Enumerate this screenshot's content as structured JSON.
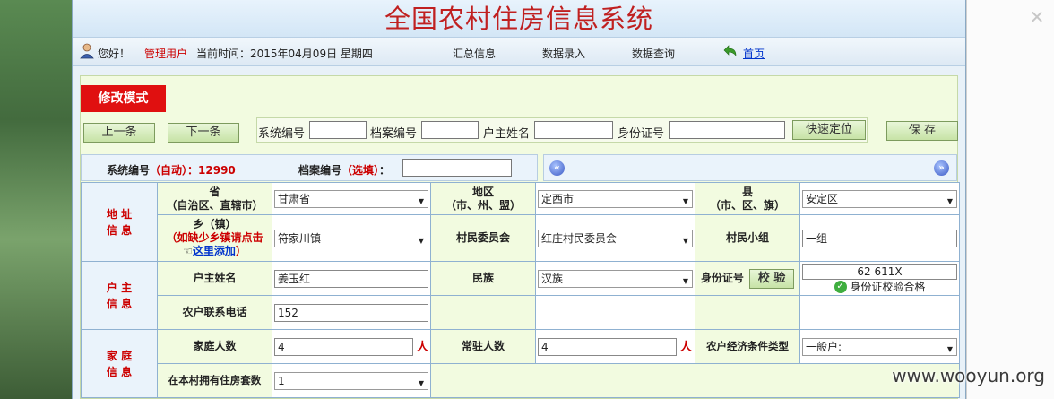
{
  "title": "全国农村住房信息系统",
  "menu": {
    "greeting": "您好！",
    "user": "管理用户",
    "time_label": "当前时间：2015年04月09日 星期四",
    "nav": [
      "汇总信息",
      "数据录入",
      "数据查询"
    ],
    "home": "首页"
  },
  "mode": "修改模式",
  "toolbar": {
    "prev": "上一条",
    "next": "下一条",
    "search_labels": [
      "系统编号",
      "档案编号",
      "户主姓名",
      "身份证号"
    ],
    "locate": "快速定位",
    "save": "保 存"
  },
  "record": {
    "sys_no_label": "系统编号",
    "sys_no_note": "（自动）：",
    "sys_no_value": "12990",
    "file_no_label": "档案编号",
    "file_no_note": "（选填）",
    "file_no_colon": "："
  },
  "nav_buttons": {
    "prev": "«",
    "next": "»"
  },
  "address": {
    "section": [
      "地 址",
      "信 息"
    ],
    "province_label": [
      "省",
      "（自治区、直辖市）"
    ],
    "province": "甘肃省",
    "region_label": [
      "地区",
      "（市、州、盟）"
    ],
    "region": "定西市",
    "county_label": [
      "县",
      "（市、区、旗）"
    ],
    "county": "安定区",
    "town_label": [
      "乡（镇）",
      "（如缺少乡镇请点击",
      "这里添加",
      "）"
    ],
    "town": "符家川镇",
    "village_label": "村民委员会",
    "village": "红庄村民委员会",
    "group_label": "村民小组",
    "group": "一组"
  },
  "owner": {
    "section": [
      "户 主",
      "信 息"
    ],
    "name_label": "户主姓名",
    "name": "姜玉红",
    "nation_label": "民族",
    "nation": "汉族",
    "id_label": "身份证号",
    "verify_button": "校 验",
    "id_value": "62                 611X",
    "verify_ok": "身份证校验合格",
    "phone_label": "农户联系电话",
    "phone": "152"
  },
  "family": {
    "section": [
      "家 庭",
      "信 息"
    ],
    "count_label": "家庭人数",
    "count": "4",
    "unit": "人",
    "resident_label": "常驻人数",
    "resident": "4",
    "econ_label": "农户经济条件类型",
    "econ": "一般户:",
    "houses_label": "在本村拥有住房套数",
    "houses": "1"
  },
  "watermark": "www.wooyun.org"
}
